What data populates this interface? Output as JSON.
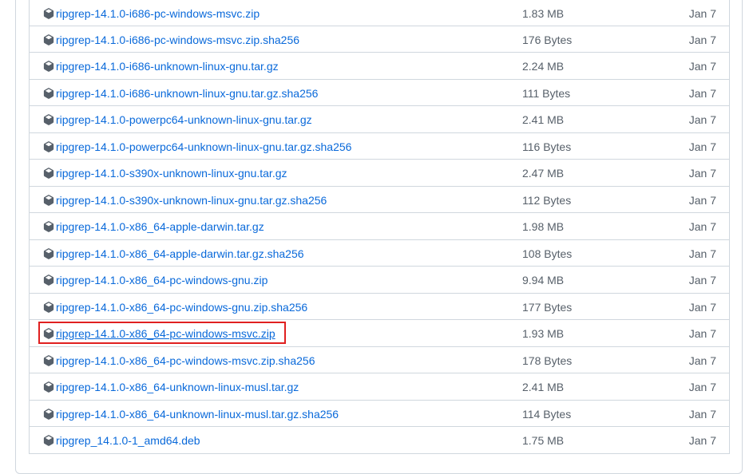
{
  "colors": {
    "link": "#0969da",
    "muted": "#57606a",
    "border": "#d0d7de",
    "highlight": "#e02020"
  },
  "assets": {
    "icon": "package-icon",
    "items": [
      {
        "name": "ripgrep-14.1.0-i686-pc-windows-msvc.zip",
        "size": "1.83 MB",
        "date": "Jan 7"
      },
      {
        "name": "ripgrep-14.1.0-i686-pc-windows-msvc.zip.sha256",
        "size": "176 Bytes",
        "date": "Jan 7"
      },
      {
        "name": "ripgrep-14.1.0-i686-unknown-linux-gnu.tar.gz",
        "size": "2.24 MB",
        "date": "Jan 7"
      },
      {
        "name": "ripgrep-14.1.0-i686-unknown-linux-gnu.tar.gz.sha256",
        "size": "111 Bytes",
        "date": "Jan 7"
      },
      {
        "name": "ripgrep-14.1.0-powerpc64-unknown-linux-gnu.tar.gz",
        "size": "2.41 MB",
        "date": "Jan 7"
      },
      {
        "name": "ripgrep-14.1.0-powerpc64-unknown-linux-gnu.tar.gz.sha256",
        "size": "116 Bytes",
        "date": "Jan 7"
      },
      {
        "name": "ripgrep-14.1.0-s390x-unknown-linux-gnu.tar.gz",
        "size": "2.47 MB",
        "date": "Jan 7"
      },
      {
        "name": "ripgrep-14.1.0-s390x-unknown-linux-gnu.tar.gz.sha256",
        "size": "112 Bytes",
        "date": "Jan 7"
      },
      {
        "name": "ripgrep-14.1.0-x86_64-apple-darwin.tar.gz",
        "size": "1.98 MB",
        "date": "Jan 7"
      },
      {
        "name": "ripgrep-14.1.0-x86_64-apple-darwin.tar.gz.sha256",
        "size": "108 Bytes",
        "date": "Jan 7"
      },
      {
        "name": "ripgrep-14.1.0-x86_64-pc-windows-gnu.zip",
        "size": "9.94 MB",
        "date": "Jan 7"
      },
      {
        "name": "ripgrep-14.1.0-x86_64-pc-windows-gnu.zip.sha256",
        "size": "177 Bytes",
        "date": "Jan 7"
      },
      {
        "name": "ripgrep-14.1.0-x86_64-pc-windows-msvc.zip",
        "size": "1.93 MB",
        "date": "Jan 7",
        "highlighted": true
      },
      {
        "name": "ripgrep-14.1.0-x86_64-pc-windows-msvc.zip.sha256",
        "size": "178 Bytes",
        "date": "Jan 7"
      },
      {
        "name": "ripgrep-14.1.0-x86_64-unknown-linux-musl.tar.gz",
        "size": "2.41 MB",
        "date": "Jan 7"
      },
      {
        "name": "ripgrep-14.1.0-x86_64-unknown-linux-musl.tar.gz.sha256",
        "size": "114 Bytes",
        "date": "Jan 7"
      },
      {
        "name": "ripgrep_14.1.0-1_amd64.deb",
        "size": "1.75 MB",
        "date": "Jan 7"
      }
    ]
  }
}
